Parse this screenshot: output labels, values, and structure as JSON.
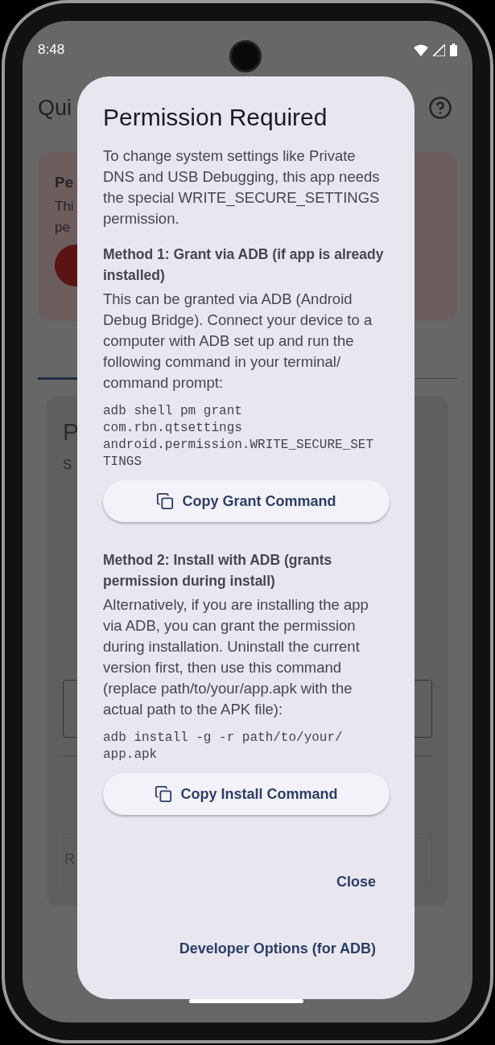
{
  "status_bar": {
    "time": "8:48"
  },
  "background": {
    "title": "Qui",
    "card": {
      "title": "Pe",
      "lines": [
        "Thi",
        "pe"
      ]
    },
    "panel": {
      "title": "P",
      "subtitle": "S",
      "field_label": "R"
    }
  },
  "dialog": {
    "title": "Permission Required",
    "intro": "To change system settings like Private DNS and USB Debugging, this app needs the special WRITE_SECURE_SETTINGS permission.",
    "methods": [
      {
        "heading": "Method 1: Grant via ADB (if app is already installed)",
        "body": "This can be granted via ADB (Android Debug Bridge). Connect your device to a computer with ADB set up and run the following command in your terminal/ command prompt:",
        "command_lines": [
          "adb shell pm grant",
          "com.rbn.qtsettings",
          "android.permission.WRITE_SECURE_SET",
          "TINGS"
        ],
        "button": "Copy Grant Command"
      },
      {
        "heading": "Method 2: Install with ADB (grants permission during install)",
        "body": "Alternatively, if you are installing the app via ADB, you can grant the permission during installation. Uninstall the current version first, then use this command (replace path/to/your/app.apk with the actual path to the APK file):",
        "command_lines": [
          "adb install -g -r path/to/your/",
          "app.apk"
        ],
        "button": "Copy Install Command"
      }
    ],
    "actions": [
      "Close",
      "Developer Options (for ADB)"
    ]
  }
}
